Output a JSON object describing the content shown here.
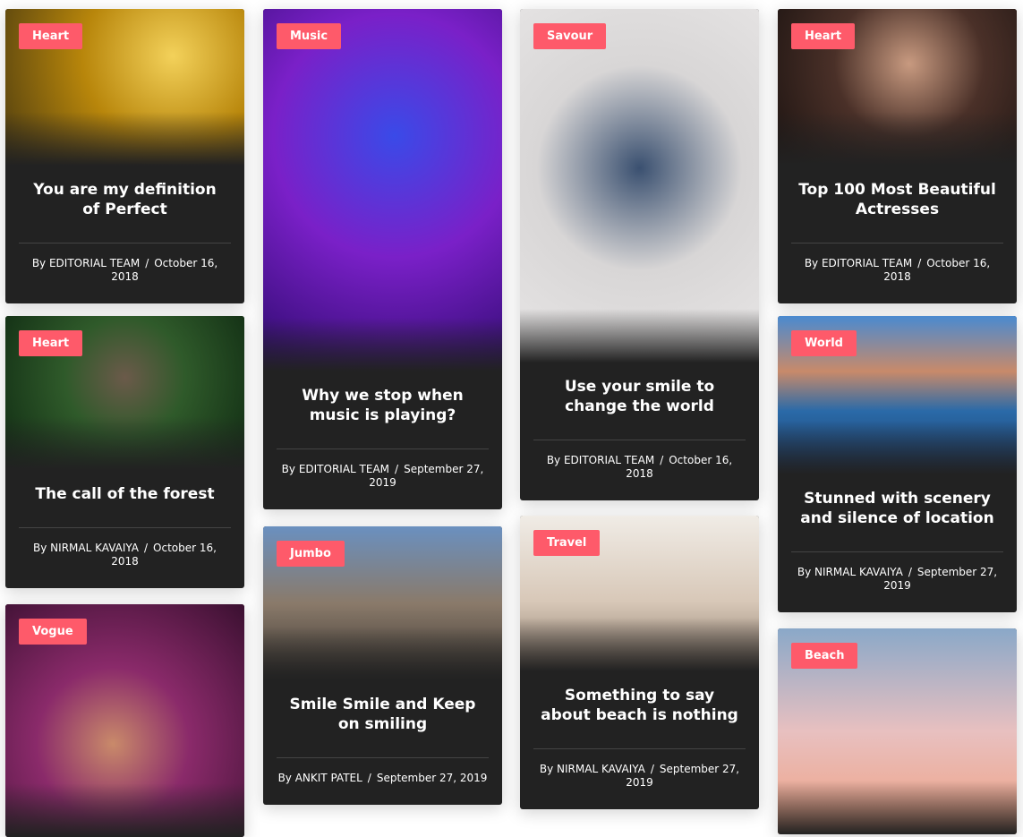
{
  "cards": [
    {
      "category": "Heart",
      "title": "You are my definition of Perfect",
      "author": "By EDITORIAL TEAM",
      "date": "October 16, 2018"
    },
    {
      "category": "Heart",
      "title": "The call of the forest",
      "author": "By NIRMAL KAVAIYA",
      "date": "October 16, 2018"
    },
    {
      "category": "Vogue",
      "title": "",
      "author": "",
      "date": ""
    },
    {
      "category": "Music",
      "title": "Why we stop when music is playing?",
      "author": "By EDITORIAL TEAM",
      "date": "September 27, 2019"
    },
    {
      "category": "Jumbo",
      "title": "Smile Smile and Keep on smiling",
      "author": "By ANKIT PATEL",
      "date": "September 27, 2019"
    },
    {
      "category": "Savour",
      "title": "Use your smile to change the world",
      "author": "By EDITORIAL TEAM",
      "date": "October 16, 2018"
    },
    {
      "category": "Travel",
      "title": "Something to say about beach is nothing",
      "author": "By NIRMAL KAVAIYA",
      "date": "September 27, 2019"
    },
    {
      "category": "Heart",
      "title": "Top 100 Most Beautiful Actresses",
      "author": "By EDITORIAL TEAM",
      "date": "October 16, 2018"
    },
    {
      "category": "World",
      "title": "Stunned with scenery and silence of location",
      "author": "By NIRMAL KAVAIYA",
      "date": "September 27, 2019"
    },
    {
      "category": "Beach",
      "title": "",
      "author": "",
      "date": ""
    }
  ],
  "meta_separator": "/",
  "colors": {
    "badge": "#fe5a6a",
    "card": "#222222"
  }
}
